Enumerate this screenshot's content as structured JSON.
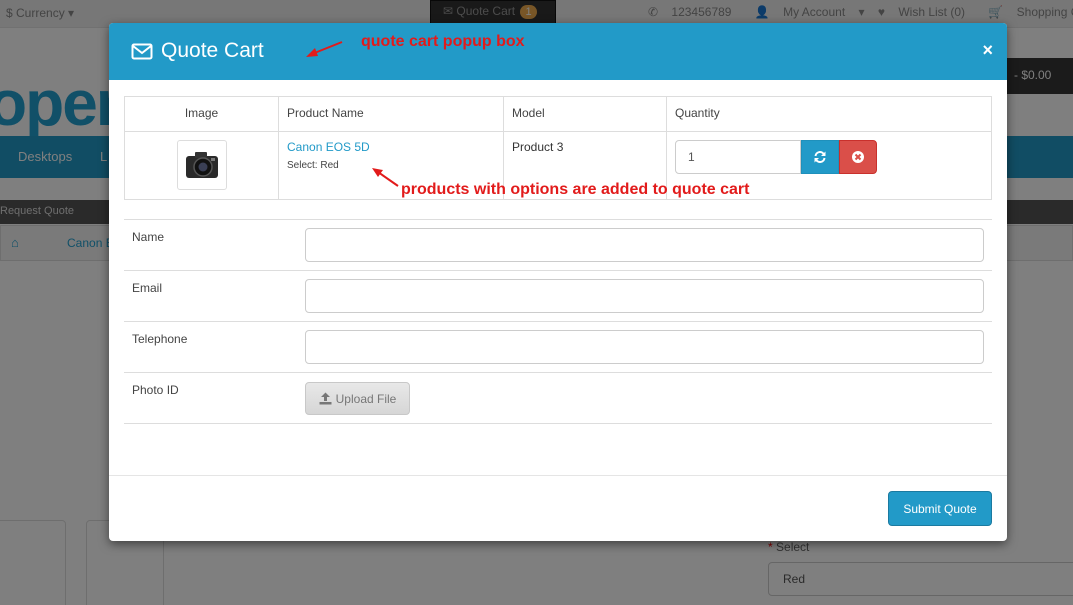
{
  "background": {
    "currency": "$ Currency",
    "quote_cart_label": "Quote Cart",
    "quote_cart_count": "1",
    "phone": "123456789",
    "my_account": "My Account",
    "wish_list": "Wish List (0)",
    "shopping_cart": "Shopping Cart",
    "checkout_partial": "C",
    "logo_text": "open",
    "cart_total": "- $0.00",
    "nav_items": [
      "Desktops",
      "L"
    ],
    "request_quote_bar": "Request Quote",
    "breadcrumb_item": "Canon E",
    "select_label": "Select",
    "select_value": "Red"
  },
  "modal": {
    "title": "Quote Cart",
    "close": "×",
    "table": {
      "headers": [
        "Image",
        "Product Name",
        "Model",
        "Quantity"
      ],
      "rows": [
        {
          "product_name": "Canon EOS 5D",
          "option": "Select: Red",
          "model": "Product 3",
          "quantity": "1"
        }
      ]
    },
    "form": {
      "name_label": "Name",
      "email_label": "Email",
      "telephone_label": "Telephone",
      "photo_label": "Photo ID",
      "upload_label": "Upload File"
    },
    "submit_label": "Submit Quote"
  },
  "annotations": {
    "popup_note": "quote cart popup box",
    "options_note": "products with options are added to quote cart"
  },
  "colors": {
    "primary": "#229ac8",
    "danger": "#da4f49",
    "annotation": "#e21b1b"
  }
}
